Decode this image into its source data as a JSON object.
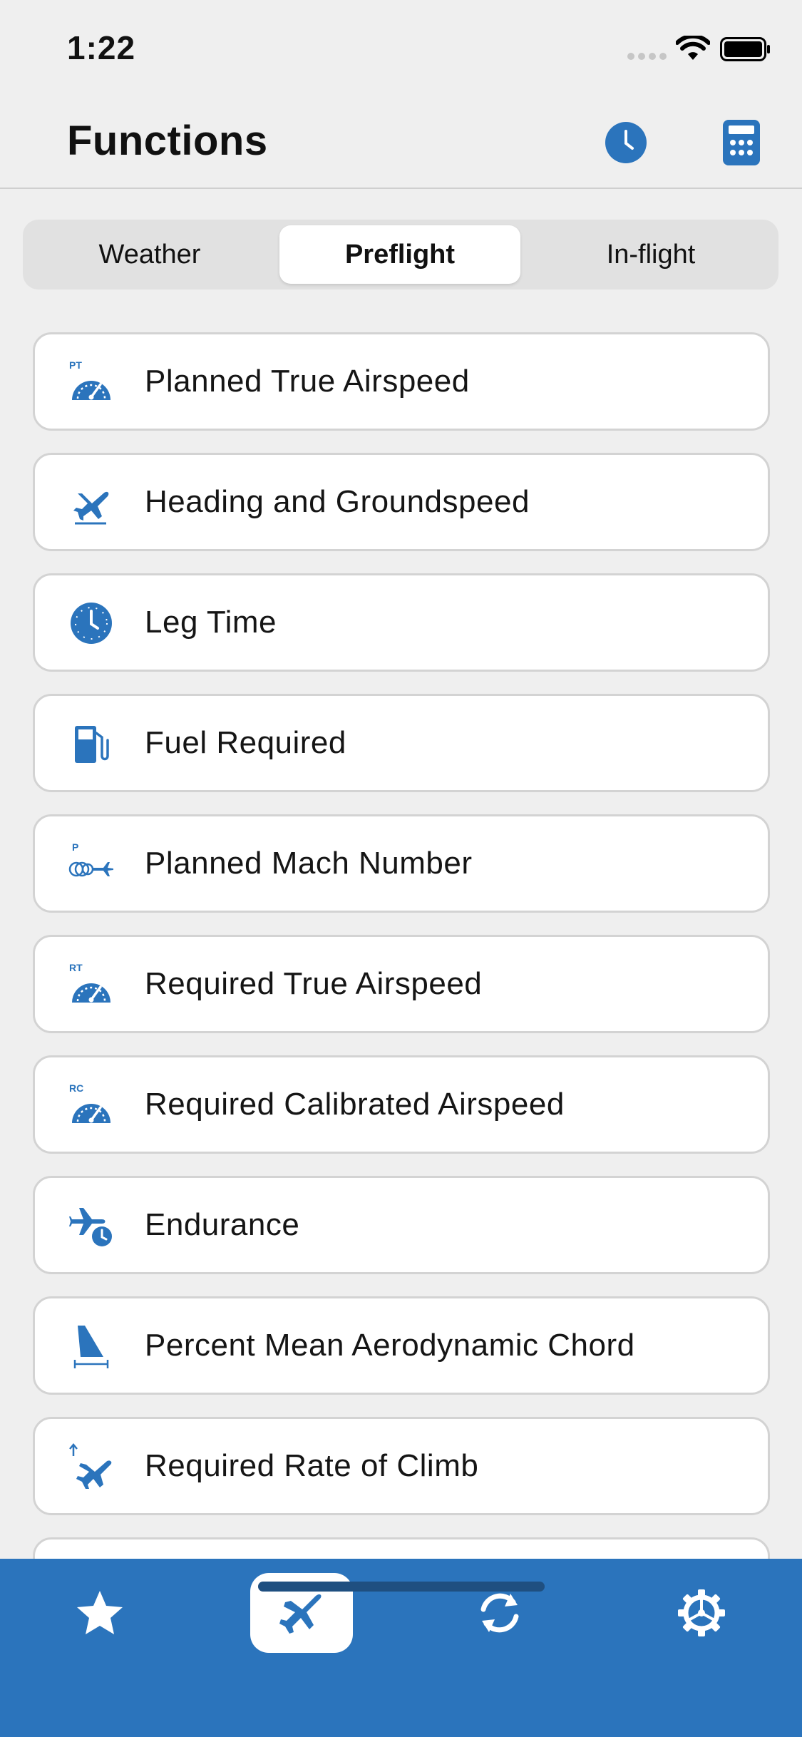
{
  "status_bar": {
    "time": "1:22"
  },
  "header": {
    "title": "Functions",
    "history_icon": "clock-icon",
    "calculator_icon": "calculator-icon"
  },
  "segments": [
    {
      "label": "Weather",
      "selected": false
    },
    {
      "label": "Preflight",
      "selected": true
    },
    {
      "label": "In-flight",
      "selected": false
    }
  ],
  "functions": [
    {
      "label": "Planned True Airspeed",
      "icon": "speedometer-icon",
      "badge": "PT"
    },
    {
      "label": "Heading and Groundspeed",
      "icon": "airplane-heading-icon"
    },
    {
      "label": "Leg Time",
      "icon": "clock-icon"
    },
    {
      "label": "Fuel Required",
      "icon": "fuel-pump-icon"
    },
    {
      "label": "Planned Mach Number",
      "icon": "mach-icon",
      "badge": "P"
    },
    {
      "label": "Required True Airspeed",
      "icon": "speedometer-icon",
      "badge": "RT"
    },
    {
      "label": "Required Calibrated Airspeed",
      "icon": "speedometer-icon",
      "badge": "RC"
    },
    {
      "label": "Endurance",
      "icon": "airplane-clock-icon"
    },
    {
      "label": "Percent Mean Aerodynamic Chord",
      "icon": "wing-chord-icon"
    },
    {
      "label": "Required Rate of Climb",
      "icon": "climb-icon"
    }
  ],
  "tab_bar": {
    "tabs": [
      {
        "icon": "star-icon",
        "selected": false
      },
      {
        "icon": "airplane-icon",
        "selected": true
      },
      {
        "icon": "sync-icon",
        "selected": false
      },
      {
        "icon": "gear-icon",
        "selected": false
      }
    ]
  },
  "colors": {
    "accent": "#2b74bc",
    "background": "#efefef",
    "card": "#ffffff"
  }
}
